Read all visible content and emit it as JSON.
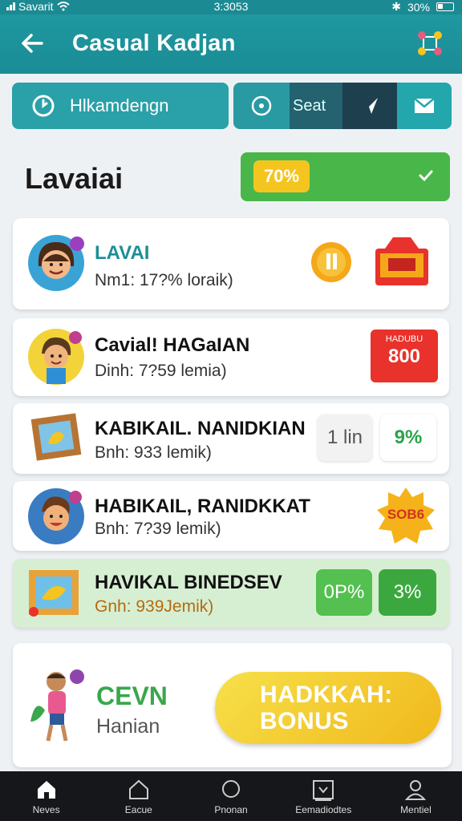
{
  "status": {
    "carrier": "Savarit",
    "time": "3:3053",
    "battery": "30%"
  },
  "header": {
    "title": "Casual Kadjan"
  },
  "toolbar": {
    "search_label": "Hlkamdengn",
    "seg_label": "Seat"
  },
  "section": {
    "title": "Lavaiai",
    "progress": {
      "label": "70%",
      "value": 0.7
    }
  },
  "cards": [
    {
      "name": "LAVAI",
      "sub": "Nm1: 17?% loraik)",
      "badge": "",
      "chip_a": "",
      "chip_b": ""
    },
    {
      "name": "Cavial! HAGaIAN",
      "sub": "Dinh: 7?59 lemia)",
      "badge": "800",
      "badge_top": "HADUBU"
    },
    {
      "name": "KABIKAIL. NANIDKIAN",
      "sub": "Bnh: 933 lemik)",
      "chip_a": "1 lin",
      "chip_b": "9%"
    },
    {
      "name": "HABIKAIL, RANIDKKAT",
      "sub": "Bnh: 7?39 lemik)",
      "badge": "SOB6"
    },
    {
      "name": "HAVIKAL BINEDSEV",
      "sub": "Gnh: 939Jemik)",
      "chip_a": "0P%",
      "chip_b": "3%"
    }
  ],
  "bottom": {
    "title": "CEVN",
    "subtitle": "Hanian",
    "bonus": "HADKKAH: BONUS"
  },
  "nav": [
    {
      "label": "Neves",
      "icon": "home-icon"
    },
    {
      "label": "Eacue",
      "icon": "house-outline-icon"
    },
    {
      "label": "Pnonan",
      "icon": "search-icon"
    },
    {
      "label": "Eemadiodtes",
      "icon": "download-box-icon"
    },
    {
      "label": "Mentiel",
      "icon": "profile-icon"
    }
  ],
  "colors": {
    "primary": "#1b8a93",
    "green": "#49b64a",
    "yellow": "#f5c51f"
  }
}
